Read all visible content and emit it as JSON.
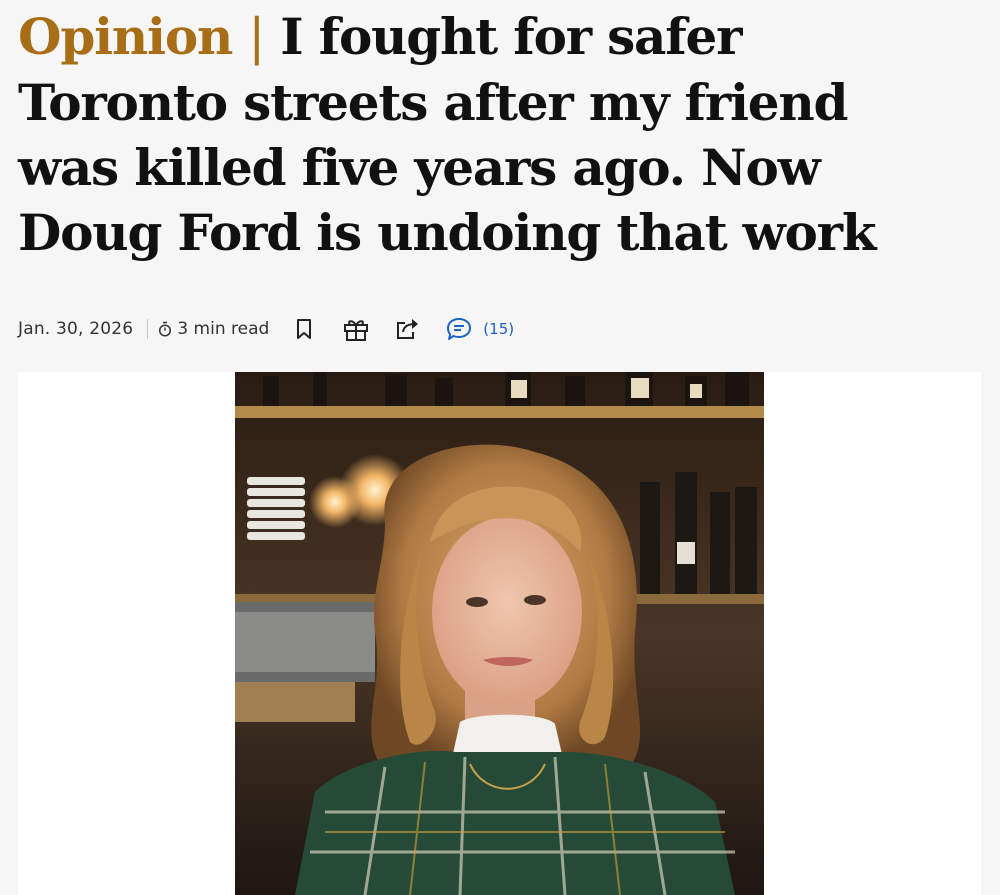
{
  "article": {
    "kicker": "Opinion",
    "separator": "|",
    "title": "I fought for safer Toronto streets after my friend was killed five years ago. Now Doug Ford is undoing that work"
  },
  "meta": {
    "date": "Jan. 30, 2026",
    "read_time": "3 min read",
    "comment_count": "(15)",
    "icons": [
      "stopwatch-icon",
      "bookmark-icon",
      "gift-icon",
      "share-icon",
      "comment-icon"
    ]
  },
  "colors": {
    "kicker": "#a86d17",
    "accent_link": "#1a63c6",
    "headline": "#111111"
  }
}
